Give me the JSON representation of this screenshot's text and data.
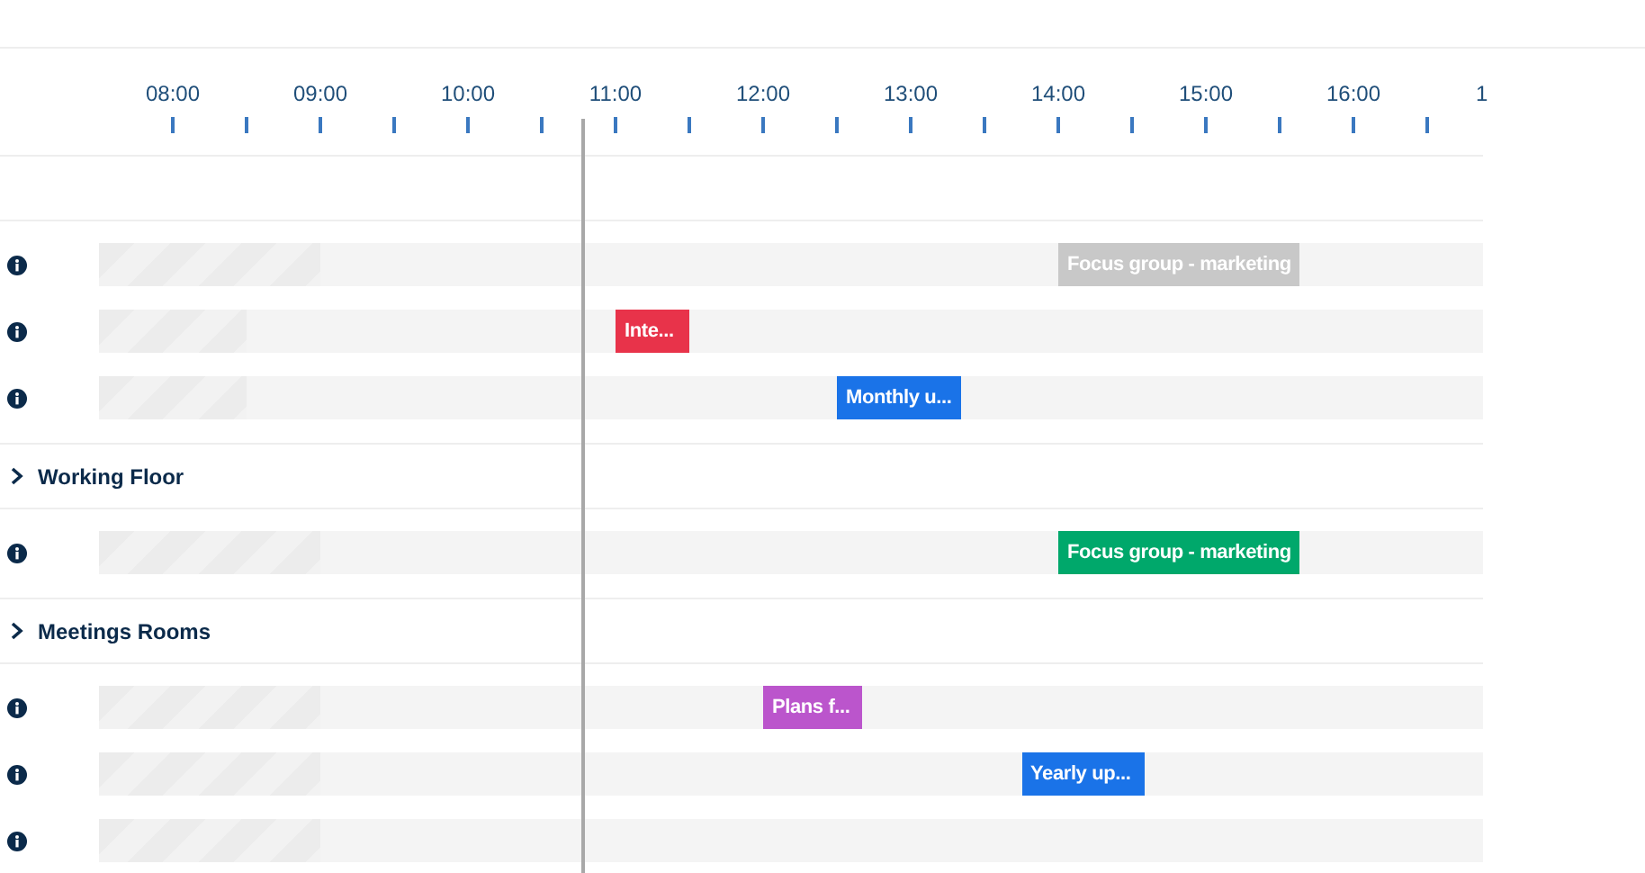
{
  "axis": {
    "labels": [
      {
        "text": "08:00"
      },
      {
        "text": "09:00"
      },
      {
        "text": "10:00"
      },
      {
        "text": "11:00"
      },
      {
        "text": "12:00"
      },
      {
        "text": "13:00"
      },
      {
        "text": "14:00"
      },
      {
        "text": "15:00"
      },
      {
        "text": "16:00"
      },
      {
        "text": "1"
      }
    ]
  },
  "sections": [
    {
      "rows": [
        {
          "level": 0.16,
          "events": [
            {
              "title": "Focus group - marketing",
              "color": "#c8c8c8"
            }
          ]
        },
        {
          "level": 0.107,
          "events": [
            {
              "title": "Inte...",
              "color": "#e8334a"
            }
          ]
        },
        {
          "level": 0.107,
          "events": [
            {
              "title": "Monthly u...",
              "color": "#1a73e8"
            }
          ]
        }
      ]
    },
    {
      "label": "Working Floor",
      "rows": [
        {
          "level": 0.16,
          "events": [
            {
              "title": "Focus group - marketing",
              "color": "#00a86b"
            }
          ]
        }
      ]
    },
    {
      "label": "Meetings Rooms",
      "rows": [
        {
          "level": 0.16,
          "events": [
            {
              "title": "Plans f...",
              "color": "#bb55cc"
            }
          ]
        },
        {
          "level": 0.16,
          "events": [
            {
              "title": "Yearly up...",
              "color": "#1a73e8"
            }
          ]
        },
        {
          "level": 0.16,
          "events": []
        }
      ]
    }
  ]
}
